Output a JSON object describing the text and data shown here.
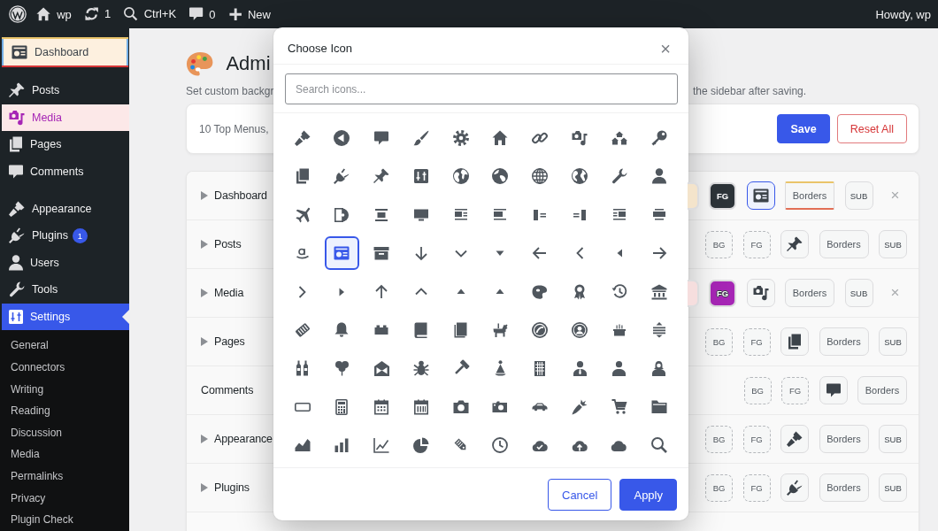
{
  "admin_bar": {
    "items": [
      {
        "kind": "logo"
      },
      {
        "kind": "home",
        "label": "wp"
      },
      {
        "kind": "updates",
        "label": "1"
      },
      {
        "kind": "search",
        "label": "Ctrl+K"
      },
      {
        "kind": "comments",
        "label": "0"
      },
      {
        "kind": "new",
        "label": "New"
      }
    ],
    "account": "Howdy, wp"
  },
  "sidebar": {
    "groups": [
      {
        "items": [
          {
            "kind": "dashboard",
            "label": "Dashboard",
            "selected": false,
            "colors": [
              {
                "kind": "background",
                "color": "#fdf0df"
              },
              {
                "kind": "text",
                "color": "#3c434a"
              },
              {
                "kind": "border_top",
                "color": "#e9c46a"
              },
              {
                "kind": "border_right",
                "color": "#72aee6"
              },
              {
                "kind": "border_bottom",
                "color": "#d63638"
              },
              {
                "kind": "border_left",
                "color": "#72aee6"
              }
            ]
          }
        ]
      },
      {
        "items": [
          {
            "kind": "pin",
            "label": "Posts",
            "selected": false
          },
          {
            "kind": "media",
            "label": "Media",
            "selected": false,
            "colors": [
              {
                "kind": "background",
                "color": "#fce8e8"
              },
              {
                "kind": "text",
                "color": "#a626b5"
              }
            ]
          },
          {
            "kind": "pages",
            "label": "Pages",
            "selected": false
          },
          {
            "kind": "bubble",
            "label": "Comments",
            "selected": false
          }
        ]
      },
      {
        "items": [
          {
            "kind": "paintbrush",
            "label": "Appearance",
            "selected": false
          },
          {
            "kind": "plug",
            "label": "Plugins",
            "selected": false,
            "badge": "1"
          },
          {
            "kind": "user",
            "label": "Users",
            "selected": false
          },
          {
            "kind": "wrench",
            "label": "Tools",
            "selected": false
          },
          {
            "kind": "sliders",
            "label": "Settings",
            "selected": true,
            "submenu": [
              {
                "label": "General",
                "selected": false
              },
              {
                "label": "Connectors",
                "selected": false
              },
              {
                "label": "Writing",
                "selected": false
              },
              {
                "label": "Reading",
                "selected": false
              },
              {
                "label": "Discussion",
                "selected": false
              },
              {
                "label": "Media",
                "selected": false
              },
              {
                "label": "Permalinks",
                "selected": false
              },
              {
                "label": "Privacy",
                "selected": false
              },
              {
                "label": "Plugin Check",
                "selected": false
              }
            ]
          }
        ]
      }
    ]
  },
  "page": {
    "title": "Admi",
    "description": [
      "Set custom backgr",
      "the sidebar after saving."
    ],
    "summary": "10 Top Menus,",
    "actions": [
      {
        "kind": "save",
        "label": "Save"
      },
      {
        "kind": "reset",
        "label": "Reset All"
      }
    ],
    "menus": [
      {
        "label": "Dashboard",
        "expandable": true,
        "controls": [
          {
            "kind": "bg",
            "color": "#f4e4cb"
          },
          {
            "kind": "fg",
            "label": "FG",
            "color": "#2c3338"
          },
          {
            "kind": "icon",
            "active": true
          },
          {
            "kind": "borders",
            "label": "Borders",
            "colors": [
              {
                "kind": "top",
                "color": "#e9c46a"
              },
              {
                "kind": "bottom",
                "color": "#e26f56"
              }
            ]
          },
          {
            "kind": "sub",
            "label": "SUB"
          },
          {
            "kind": "reset",
            "label": "×"
          }
        ]
      },
      {
        "label": "Posts",
        "expandable": true,
        "controls": [
          {
            "kind": "bg",
            "label": "BG"
          },
          {
            "kind": "fg",
            "label": "FG"
          },
          {
            "kind": "icon",
            "active": false
          },
          {
            "kind": "borders",
            "label": "Borders"
          },
          {
            "kind": "sub",
            "label": "SUB"
          }
        ]
      },
      {
        "label": "Media",
        "expandable": true,
        "controls": [
          {
            "kind": "bg",
            "color": "#f6dede"
          },
          {
            "kind": "fg",
            "label": "FG",
            "color": "#a626b5"
          },
          {
            "kind": "icon",
            "active": false
          },
          {
            "kind": "borders",
            "label": "Borders"
          },
          {
            "kind": "sub",
            "label": "SUB"
          },
          {
            "kind": "reset",
            "label": "×"
          }
        ]
      },
      {
        "label": "Pages",
        "expandable": true,
        "controls": [
          {
            "kind": "bg",
            "label": "BG"
          },
          {
            "kind": "fg",
            "label": "FG"
          },
          {
            "kind": "icon",
            "active": false
          },
          {
            "kind": "borders",
            "label": "Borders"
          },
          {
            "kind": "sub",
            "label": "SUB"
          }
        ]
      },
      {
        "label": "Comments",
        "expandable": false,
        "controls": [
          {
            "kind": "bg",
            "label": "BG"
          },
          {
            "kind": "fg",
            "label": "FG"
          },
          {
            "kind": "icon",
            "active": false
          },
          {
            "kind": "borders",
            "label": "Borders"
          }
        ]
      },
      {
        "label": "Appearance",
        "expandable": true,
        "controls": [
          {
            "kind": "bg",
            "label": "BG"
          },
          {
            "kind": "fg",
            "label": "FG"
          },
          {
            "kind": "icon",
            "active": false
          },
          {
            "kind": "borders",
            "label": "Borders"
          },
          {
            "kind": "sub",
            "label": "SUB"
          }
        ]
      },
      {
        "label": "Plugins",
        "expandable": true,
        "controls": [
          {
            "kind": "bg",
            "label": "BG"
          },
          {
            "kind": "fg",
            "label": "FG"
          },
          {
            "kind": "icon",
            "active": false
          },
          {
            "kind": "borders",
            "label": "Borders"
          },
          {
            "kind": "sub",
            "label": "SUB"
          }
        ]
      }
    ]
  },
  "modal": {
    "title": "Choose Icon",
    "close": "×",
    "search": {
      "placeholder": "Search icons..."
    },
    "icons": [
      {
        "kind": "paintbrush",
        "selected": false
      },
      {
        "kind": "back",
        "selected": false
      },
      {
        "kind": "bubble",
        "selected": false
      },
      {
        "kind": "brush",
        "selected": false
      },
      {
        "kind": "gear",
        "selected": false
      },
      {
        "kind": "home",
        "selected": false
      },
      {
        "kind": "link",
        "selected": false
      },
      {
        "kind": "media",
        "selected": false
      },
      {
        "kind": "houses",
        "selected": false
      },
      {
        "kind": "key",
        "selected": false
      },
      {
        "kind": "pages",
        "selected": false
      },
      {
        "kind": "plug",
        "selected": false
      },
      {
        "kind": "pin",
        "selected": false
      },
      {
        "kind": "sliders",
        "selected": false
      },
      {
        "kind": "globe",
        "selected": false
      },
      {
        "kind": "earth",
        "selected": false
      },
      {
        "kind": "grid",
        "selected": false
      },
      {
        "kind": "world",
        "selected": false
      },
      {
        "kind": "wrench",
        "selected": false
      },
      {
        "kind": "user",
        "selected": false
      },
      {
        "kind": "airplane",
        "selected": false
      },
      {
        "kind": "album",
        "selected": false
      },
      {
        "kind": "aligncenter",
        "selected": false
      },
      {
        "kind": "monitor",
        "selected": false
      },
      {
        "kind": "alignleft",
        "selected": false
      },
      {
        "kind": "alignnone",
        "selected": false
      },
      {
        "kind": "pullleft",
        "selected": false
      },
      {
        "kind": "pullright",
        "selected": false
      },
      {
        "kind": "alignright",
        "selected": false
      },
      {
        "kind": "alignwide",
        "selected": false
      },
      {
        "kind": "smile",
        "selected": false
      },
      {
        "kind": "dashboard",
        "selected": true
      },
      {
        "kind": "archive",
        "selected": false
      },
      {
        "kind": "arrowdown",
        "selected": false
      },
      {
        "kind": "chevrondown",
        "selected": false
      },
      {
        "kind": "caretdown",
        "selected": false
      },
      {
        "kind": "arrowleft",
        "selected": false
      },
      {
        "kind": "chevronleft",
        "selected": false
      },
      {
        "kind": "caretleft",
        "selected": false
      },
      {
        "kind": "arrowright",
        "selected": false
      },
      {
        "kind": "chevronright",
        "selected": false
      },
      {
        "kind": "caretright",
        "selected": false
      },
      {
        "kind": "arrowup",
        "selected": false
      },
      {
        "kind": "chevronup",
        "selected": false
      },
      {
        "kind": "caretup",
        "selected": false
      },
      {
        "kind": "caretup",
        "selected": false
      },
      {
        "kind": "art",
        "selected": false
      },
      {
        "kind": "award",
        "selected": false
      },
      {
        "kind": "history",
        "selected": false
      },
      {
        "kind": "bank",
        "selected": false
      },
      {
        "kind": "ticket",
        "selected": false
      },
      {
        "kind": "bell",
        "selected": false
      },
      {
        "kind": "block",
        "selected": false
      },
      {
        "kind": "book",
        "selected": false
      },
      {
        "kind": "bookalt",
        "selected": false
      },
      {
        "kind": "dog",
        "selected": false
      },
      {
        "kind": "emblem",
        "selected": false
      },
      {
        "kind": "usercircle",
        "selected": false
      },
      {
        "kind": "cake",
        "selected": false
      },
      {
        "kind": "stack",
        "selected": false
      },
      {
        "kind": "bottles",
        "selected": false
      },
      {
        "kind": "balloons",
        "selected": false
      },
      {
        "kind": "envelope",
        "selected": false
      },
      {
        "kind": "bug",
        "selected": false
      },
      {
        "kind": "hammer",
        "selected": false
      },
      {
        "kind": "party",
        "selected": false
      },
      {
        "kind": "building",
        "selected": false
      },
      {
        "kind": "businessman",
        "selected": false
      },
      {
        "kind": "businessperson",
        "selected": false
      },
      {
        "kind": "businesswoman",
        "selected": false
      },
      {
        "kind": "button",
        "selected": false
      },
      {
        "kind": "calculator",
        "selected": false
      },
      {
        "kind": "calendar",
        "selected": false
      },
      {
        "kind": "calendaralt",
        "selected": false
      },
      {
        "kind": "camera",
        "selected": false
      },
      {
        "kind": "cameraalt",
        "selected": false
      },
      {
        "kind": "car",
        "selected": false
      },
      {
        "kind": "carrot",
        "selected": false
      },
      {
        "kind": "cart",
        "selected": false
      },
      {
        "kind": "folder",
        "selected": false
      },
      {
        "kind": "areachart",
        "selected": false
      },
      {
        "kind": "barchart",
        "selected": false
      },
      {
        "kind": "linechart",
        "selected": false
      },
      {
        "kind": "piechart",
        "selected": false
      },
      {
        "kind": "tag",
        "selected": false
      },
      {
        "kind": "clock",
        "selected": false
      },
      {
        "kind": "cloudcheck",
        "selected": false
      },
      {
        "kind": "cloudupload",
        "selected": false
      },
      {
        "kind": "cloud",
        "selected": false
      },
      {
        "kind": "search",
        "selected": false
      }
    ],
    "buttons": [
      {
        "kind": "cancel",
        "label": "Cancel"
      },
      {
        "kind": "apply",
        "label": "Apply"
      }
    ]
  }
}
